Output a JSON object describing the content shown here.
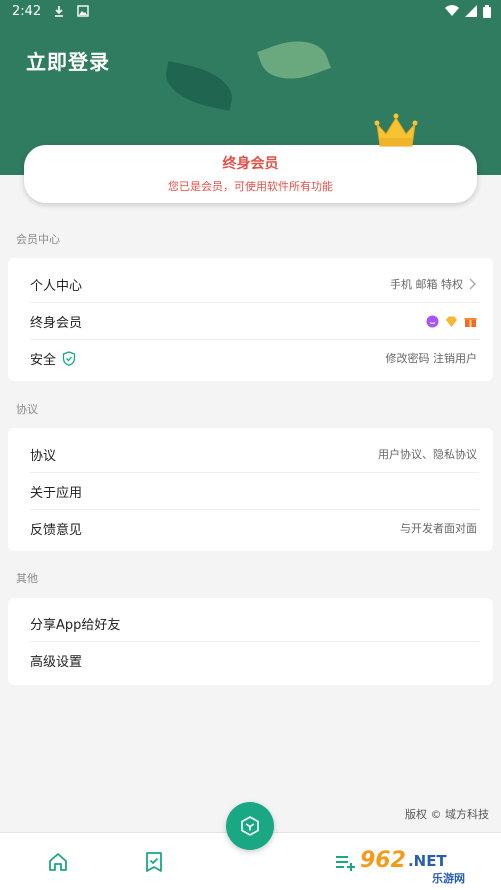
{
  "status_bar": {
    "time": "2:42"
  },
  "header": {
    "login_label": "立即登录"
  },
  "member_card": {
    "title": "终身会员",
    "subtitle": "您已是会员，可使用软件所有功能"
  },
  "sections": {
    "member_center": {
      "label": "会员中心",
      "rows": [
        {
          "label": "个人中心",
          "right": "手机 邮箱 特权"
        },
        {
          "label": "终身会员"
        },
        {
          "label": "安全",
          "right": "修改密码  注销用户"
        }
      ]
    },
    "agreements": {
      "label": "协议",
      "rows": [
        {
          "label": "协议",
          "right": "用户协议、隐私协议"
        },
        {
          "label": "关于应用"
        },
        {
          "label": "反馈意见",
          "right": "与开发者面对面"
        }
      ]
    },
    "others": {
      "label": "其他",
      "rows": [
        {
          "label": "分享App给好友"
        },
        {
          "label": "高级设置"
        }
      ]
    }
  },
  "copyright": "版权 © 域方科技",
  "watermark": {
    "number": "962",
    "suffix": ".NET",
    "text": "乐游网"
  },
  "colors": {
    "primary": "#2f7c61",
    "accent": "#1aa784",
    "member_red": "#e0534a"
  }
}
